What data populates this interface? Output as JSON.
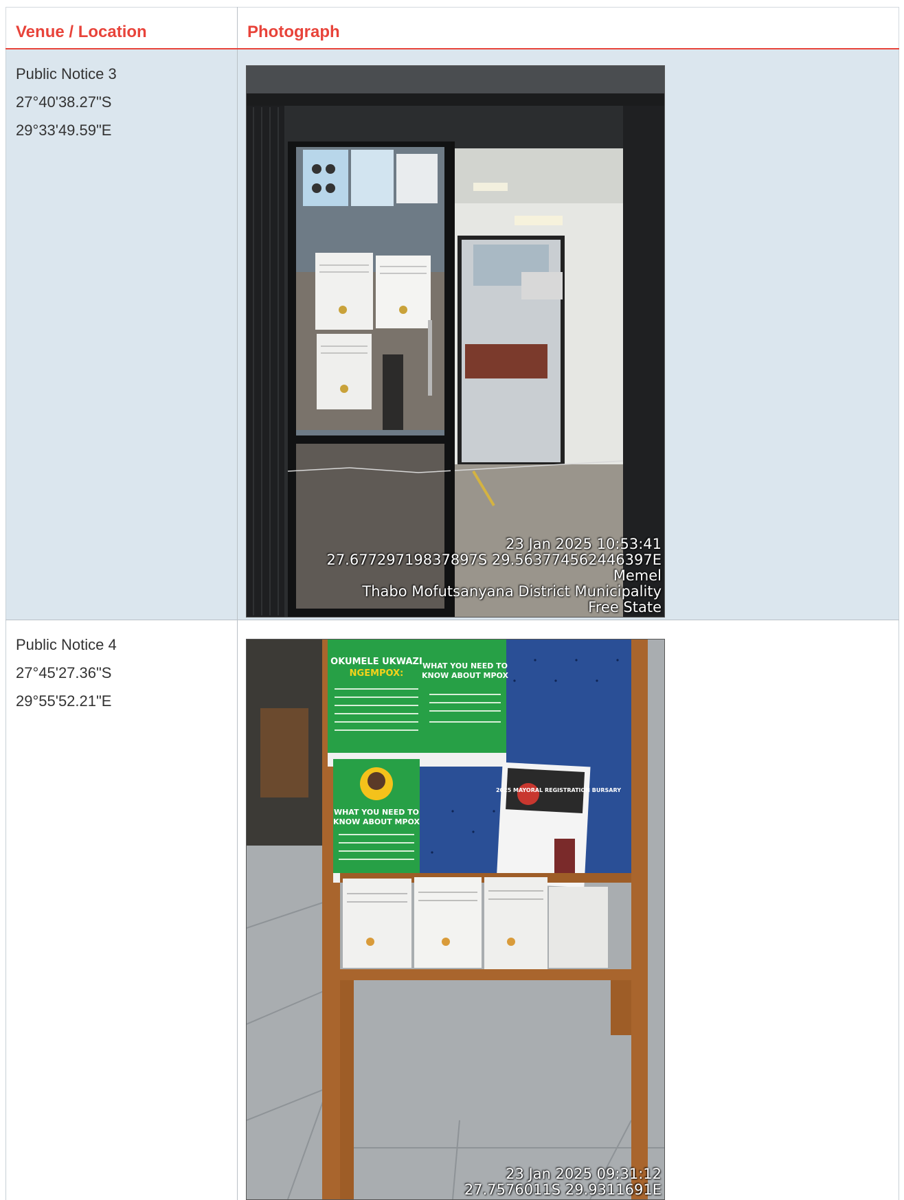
{
  "table": {
    "headers": {
      "location": "Venue / Location",
      "photograph": "Photograph"
    },
    "rows": [
      {
        "venue": "Public Notice 3",
        "latitude": "27°40'38.27\"S",
        "longitude": "29°33'49.59\"E",
        "photo_stamp": {
          "datetime": "23 Jan 2025 10:53:41",
          "coordinates": "27.67729719837897S 29.563774562446397E",
          "town": "Memel",
          "municipality": "Thabo Mofutsanyana District Municipality",
          "province": "Free State"
        },
        "photo_subject": "glass entrance door with public notices"
      },
      {
        "venue": "Public Notice 4",
        "latitude": "27°45'27.36\"S",
        "longitude": "29°55'52.21\"E",
        "photo_stamp": {
          "datetime": "23 Jan 2025 09:31:12",
          "coordinates": "27.7576011S 29.9311691E"
        },
        "photo_subject": "notice board with MPOX posters and public notices",
        "poster_text": {
          "poster_a_line1": "OKUMELE UKWAZI",
          "poster_a_line2": "NGEMPOX:",
          "poster_b_line1": "WHAT YOU NEED TO",
          "poster_b_line2": "KNOW ABOUT MPOX",
          "poster_c_line1": "WHAT YOU NEED TO",
          "poster_c_line2": "KNOW ABOUT MPOX",
          "flyer_title": "2025 MAYORAL REGISTRATION BURSARY"
        }
      }
    ]
  },
  "colors": {
    "header_text": "#e8433a",
    "row_shade": "#dbe6ee",
    "accent_line": "#e8433a"
  }
}
